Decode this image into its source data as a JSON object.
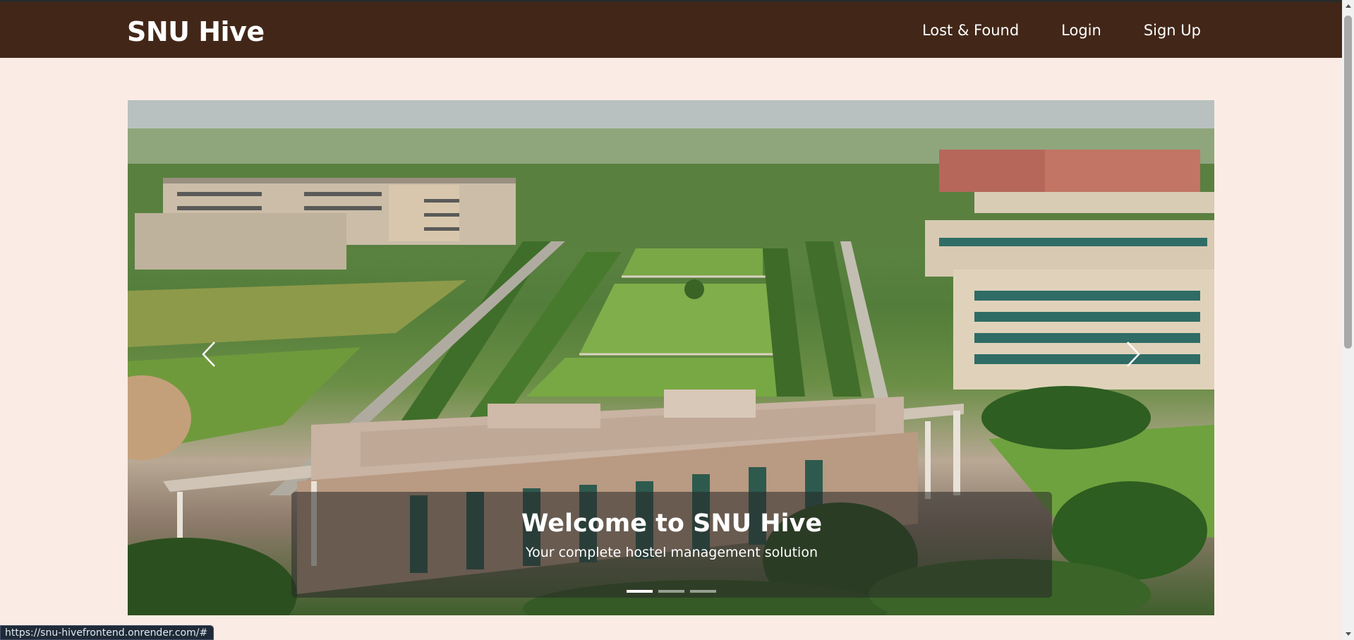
{
  "navbar": {
    "brand": "SNU Hive",
    "links": [
      {
        "label": "Lost & Found"
      },
      {
        "label": "Login"
      },
      {
        "label": "Sign Up"
      }
    ],
    "background_color": "#422718"
  },
  "page": {
    "background_color": "#faece4"
  },
  "carousel": {
    "caption_title": "Welcome to SNU Hive",
    "caption_subtitle": "Your complete hostel management solution",
    "slide_count": 3,
    "active_slide": 1,
    "prev_icon": "chevron-left-icon",
    "next_icon": "chevron-right-icon"
  },
  "status_bar": {
    "url": "https://snu-hivefrontend.onrender.com/#"
  }
}
